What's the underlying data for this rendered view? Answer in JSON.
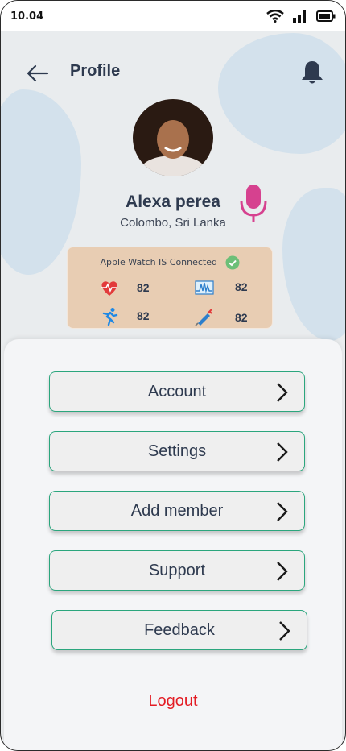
{
  "status_bar": {
    "time": "10.04"
  },
  "header": {
    "title": "Profile"
  },
  "profile": {
    "name": "Alexa perea",
    "location": "Colombo, Sri Lanka"
  },
  "watch": {
    "status": "Apple Watch IS Connected",
    "stats": [
      {
        "icon": "heart-rate-icon",
        "value": "82"
      },
      {
        "icon": "pulse-graph-icon",
        "value": "82"
      },
      {
        "icon": "running-icon",
        "value": "82"
      },
      {
        "icon": "syringe-icon",
        "value": "82"
      }
    ]
  },
  "menu": [
    {
      "label": "Account"
    },
    {
      "label": "Settings"
    },
    {
      "label": "Add member"
    },
    {
      "label": "Support"
    },
    {
      "label": "Feedback"
    }
  ],
  "logout": "Logout",
  "colors": {
    "accent_border": "#2ba67d",
    "logout": "#e31b23",
    "mic": "#d6418f",
    "card": "#e8cdb3"
  }
}
